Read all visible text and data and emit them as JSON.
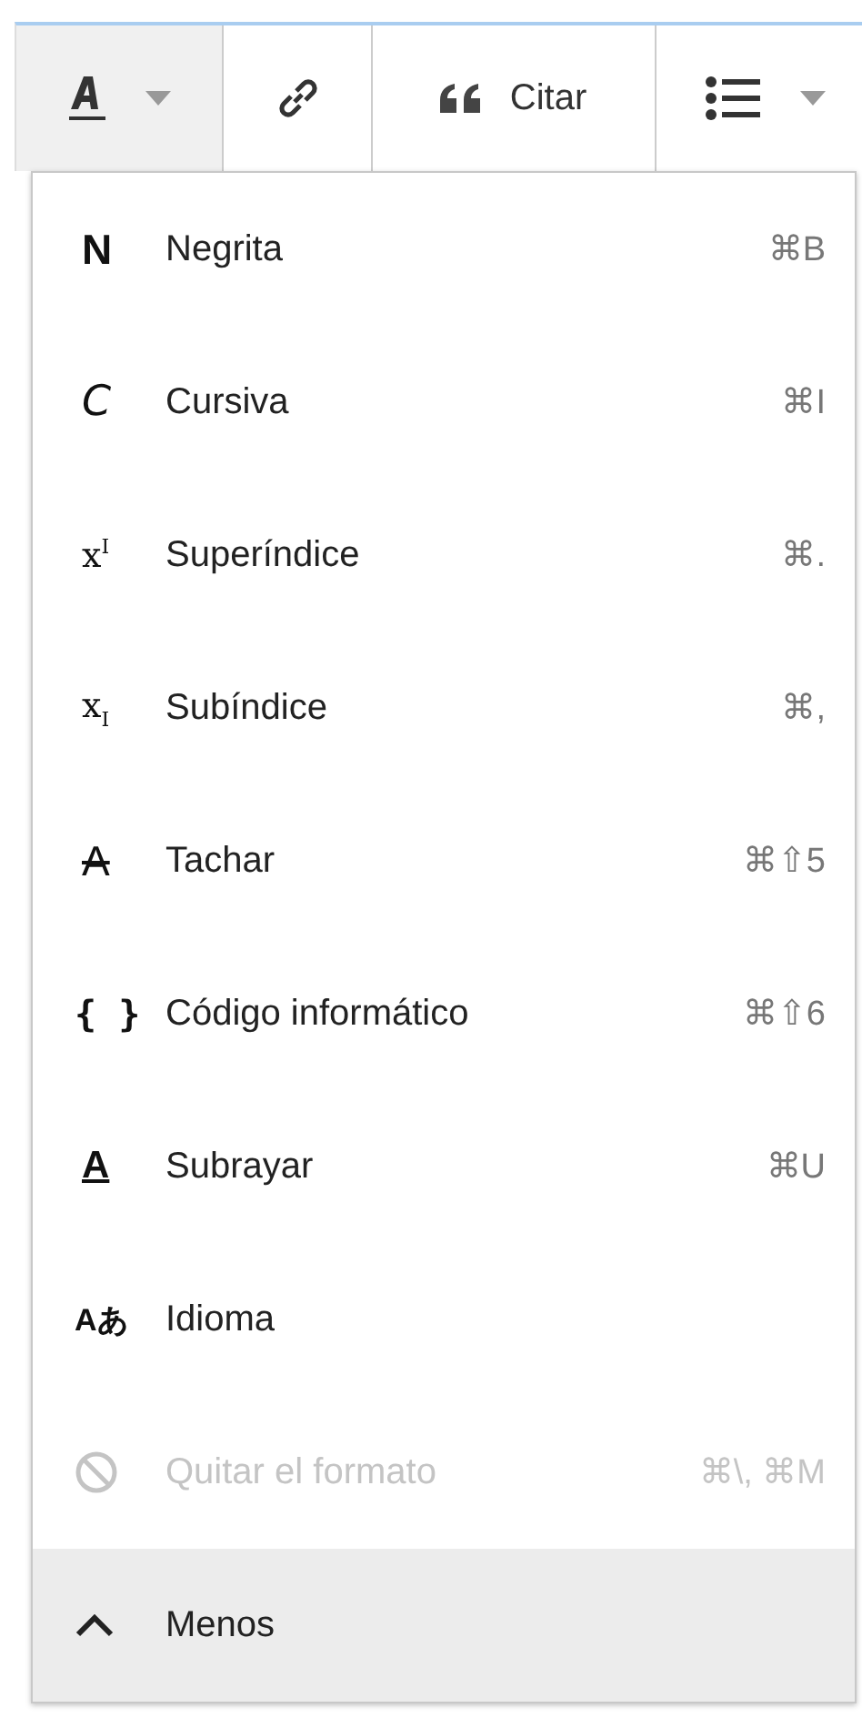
{
  "toolbar": [
    {
      "kind": "style",
      "active": true,
      "dropdown": true
    },
    {
      "kind": "link",
      "active": false,
      "dropdown": false
    },
    {
      "kind": "quote",
      "active": false,
      "dropdown": false,
      "label": "Citar"
    },
    {
      "kind": "list",
      "active": false,
      "dropdown": true
    }
  ],
  "menu": {
    "items": [
      {
        "kind": "bold",
        "glyph": "N",
        "label": "Negrita",
        "shortcut": "⌘B",
        "disabled": false,
        "highlighted": false
      },
      {
        "kind": "italic",
        "glyph": "C",
        "label": "Cursiva",
        "shortcut": "⌘I",
        "disabled": false,
        "highlighted": false
      },
      {
        "kind": "superscript",
        "glyph": "x$^{I}$",
        "label": "Superíndice",
        "shortcut": "⌘.",
        "disabled": false,
        "highlighted": false
      },
      {
        "kind": "subscript",
        "glyph": "x$_{I}$",
        "label": "Subíndice",
        "shortcut": "⌘,",
        "disabled": false,
        "highlighted": false
      },
      {
        "kind": "strike",
        "glyph": "A",
        "label": "Tachar",
        "shortcut": "⌘⇧5",
        "disabled": false,
        "highlighted": false
      },
      {
        "kind": "code",
        "glyph": "{ }",
        "label": "Código informático",
        "shortcut": "⌘⇧6",
        "disabled": false,
        "highlighted": false
      },
      {
        "kind": "underline",
        "glyph": "A",
        "label": "Subrayar",
        "shortcut": "⌘U",
        "disabled": false,
        "highlighted": false
      },
      {
        "kind": "language",
        "glyph": "Aあ",
        "label": "Idioma",
        "disabled": false,
        "highlighted": false
      },
      {
        "kind": "clear",
        "label": "Quitar el formato",
        "shortcut": "⌘\\, ⌘M",
        "disabled": true,
        "highlighted": false
      },
      {
        "kind": "collapse",
        "label": "Menos",
        "disabled": false,
        "highlighted": true
      }
    ]
  }
}
